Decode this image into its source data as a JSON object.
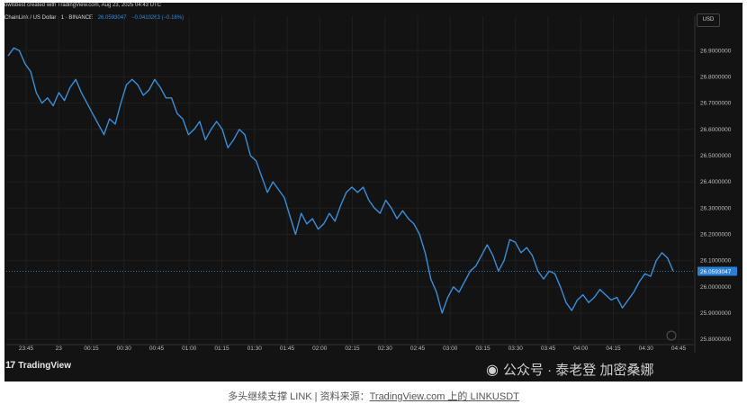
{
  "header": {
    "meta": "owlsbest created with TradingView.com, Aug 23, 2025 04:43 UTC",
    "symbol": "ChainLink / US Dollar · 1 · BINANCE",
    "price": "26.0593047",
    "change": "−0.0410263 (−0.16%)",
    "currency": "USD"
  },
  "footer": {
    "logo_text": "TradingView",
    "watermark": "公众号 · 泰老登 加密桑娜",
    "caption_prefix": "多头继续支撑 LINK | 资料来源：",
    "caption_link": "TradingView.com 上的 LINKUSDT"
  },
  "colors": {
    "line": "#3a8fd9",
    "background": "#131313",
    "price_label": "#2a7fd4"
  },
  "chart_data": {
    "type": "line",
    "title": "",
    "xlabel": "",
    "ylabel": "",
    "x_ticks": [
      "23:45",
      "23",
      "00:15",
      "00:30",
      "00:45",
      "01:00",
      "01:15",
      "01:30",
      "01:45",
      "02:00",
      "02:15",
      "02:30",
      "02:45",
      "03:00",
      "03:15",
      "03:30",
      "03:45",
      "04:00",
      "04:15",
      "04:30",
      "04:45"
    ],
    "y_ticks": [
      "25.8000000",
      "25.9000000",
      "26.0000000",
      "26.1000000",
      "26.2000000",
      "26.3000000",
      "26.4000000",
      "26.5000000",
      "26.6000000",
      "26.7000000",
      "26.8000000",
      "26.9000000"
    ],
    "ylim": [
      25.78,
      26.99
    ],
    "last_price_label": "26.0593047",
    "last_price": 26.0593047,
    "grid": true,
    "series": [
      {
        "values": [
          26.88,
          26.91,
          26.9,
          26.85,
          26.82,
          26.74,
          26.7,
          26.72,
          26.69,
          26.74,
          26.71,
          26.76,
          26.79,
          26.74,
          26.7,
          26.66,
          26.62,
          26.58,
          26.64,
          26.62,
          26.7,
          26.77,
          26.79,
          26.77,
          26.73,
          26.75,
          26.79,
          26.76,
          26.72,
          26.72,
          26.66,
          26.64,
          26.58,
          26.6,
          26.63,
          26.56,
          26.6,
          26.63,
          26.6,
          26.53,
          26.56,
          26.6,
          26.58,
          26.5,
          26.48,
          26.42,
          26.36,
          26.4,
          26.37,
          26.34,
          26.27,
          26.2,
          26.28,
          26.24,
          26.26,
          26.22,
          26.24,
          26.28,
          26.25,
          26.31,
          26.36,
          26.38,
          26.36,
          26.38,
          26.33,
          26.3,
          26.28,
          26.33,
          26.3,
          26.26,
          26.29,
          26.26,
          26.24,
          26.2,
          26.13,
          26.03,
          25.98,
          25.9,
          25.96,
          26.0,
          25.98,
          26.02,
          26.06,
          26.08,
          26.12,
          26.16,
          26.12,
          26.06,
          26.1,
          26.18,
          26.17,
          26.13,
          26.15,
          26.12,
          26.06,
          26.03,
          26.06,
          26.05,
          26.0,
          25.94,
          25.91,
          25.95,
          25.97,
          25.94,
          25.96,
          25.99,
          25.97,
          25.95,
          25.96,
          25.92,
          25.95,
          25.98,
          26.02,
          26.05,
          26.04,
          26.1,
          26.13,
          26.11,
          26.06
        ]
      }
    ]
  }
}
